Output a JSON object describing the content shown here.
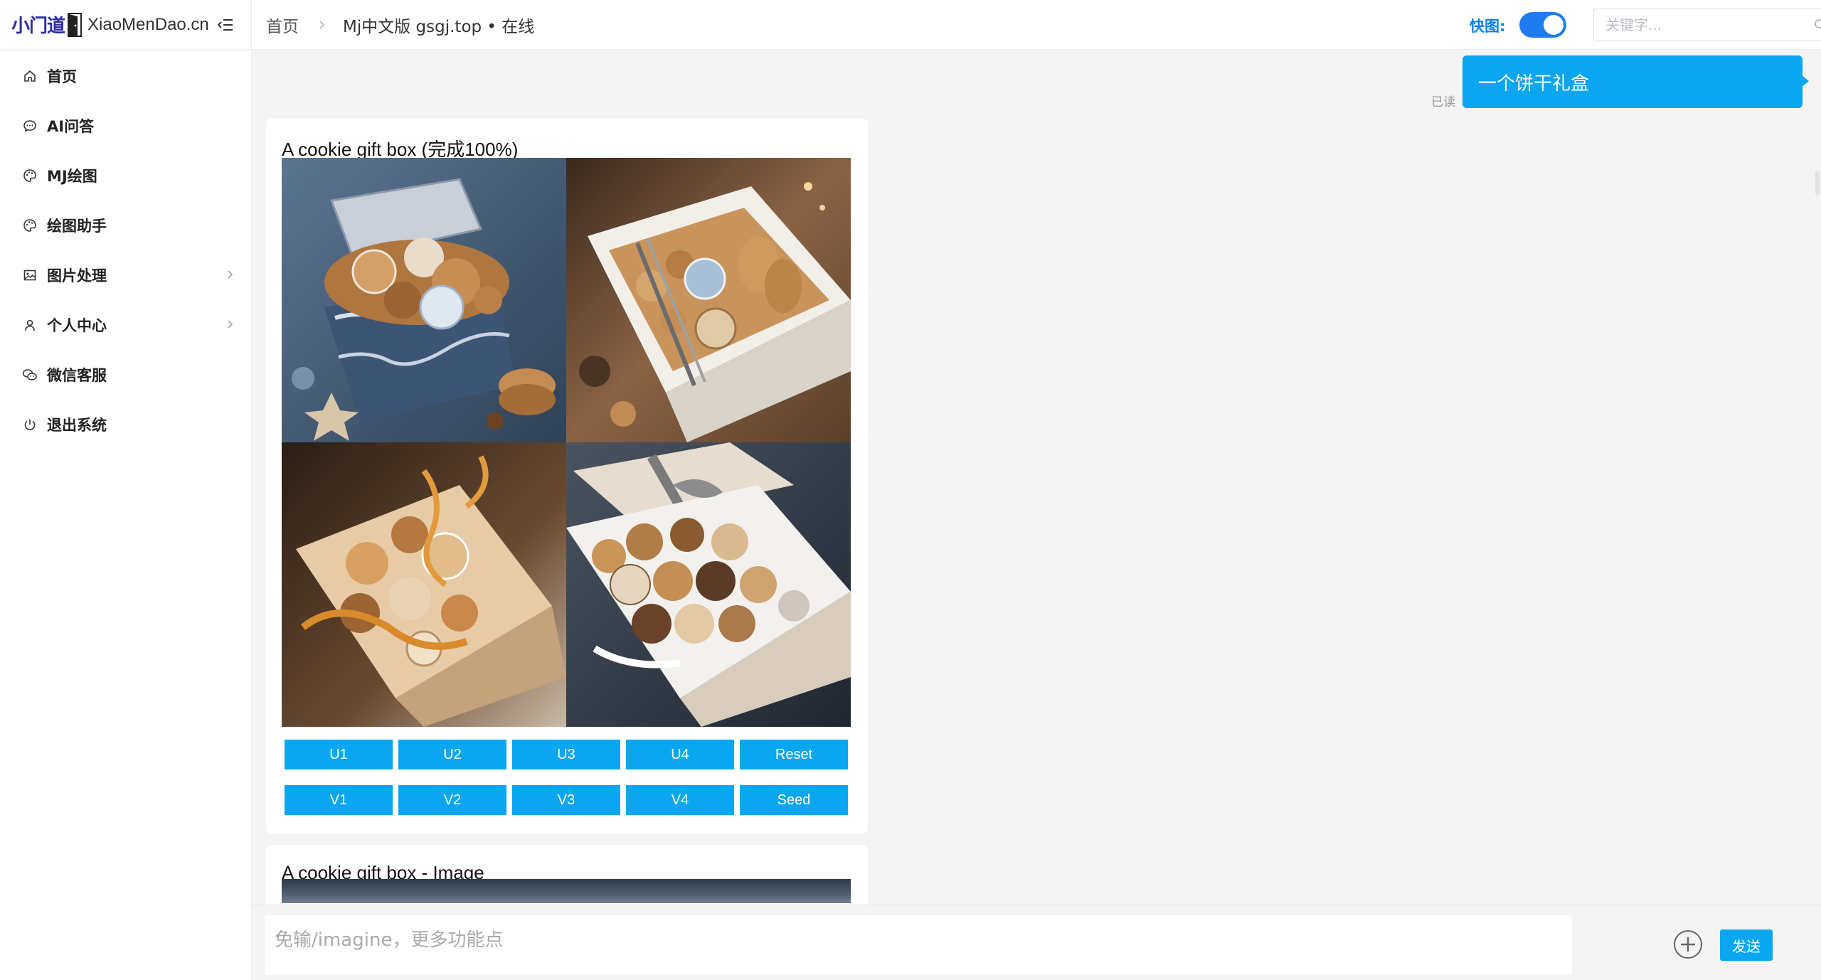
{
  "brand": {
    "name_cn": "小门道",
    "name_en": "XiaoMenDao.cn"
  },
  "sidebar": {
    "collapse_icon": "fold-menu-icon",
    "items": [
      {
        "label": "首页",
        "icon": "home-icon",
        "has_arrow": false
      },
      {
        "label": "AI问答",
        "icon": "chat-bubble-icon",
        "has_arrow": false
      },
      {
        "label": "MJ绘图",
        "icon": "palette-icon",
        "has_arrow": false
      },
      {
        "label": "绘图助手",
        "icon": "palette-icon",
        "has_arrow": false
      },
      {
        "label": "图片处理",
        "icon": "image-icon",
        "has_arrow": true
      },
      {
        "label": "个人中心",
        "icon": "user-icon",
        "has_arrow": true
      },
      {
        "label": "微信客服",
        "icon": "wechat-icon",
        "has_arrow": false
      },
      {
        "label": "退出系统",
        "icon": "power-icon",
        "has_arrow": false
      }
    ]
  },
  "header": {
    "breadcrumb_home": "首页",
    "breadcrumb_current": "Mj中文版 gsgj.top • 在线",
    "fast_mode_label": "快图:",
    "fast_mode_on": true,
    "search_placeholder": "关键字..."
  },
  "chat": {
    "user_message": "一个饼干礼盒",
    "read_status": "已读",
    "result_title": "A cookie gift box (完成100%)",
    "upscale_buttons": [
      "U1",
      "U2",
      "U3",
      "U4",
      "Reset"
    ],
    "variation_buttons": [
      "V1",
      "V2",
      "V3",
      "V4",
      "Seed"
    ],
    "second_title": "A cookie gift box - Image"
  },
  "input": {
    "placeholder": "免输/imagine，更多功能点",
    "send_label": "发送"
  },
  "colors": {
    "accent": "#0aa6f0",
    "toggle": "#1e7cf0",
    "brand": "#2d2d9f",
    "fast_label": "#0a7ff5"
  }
}
